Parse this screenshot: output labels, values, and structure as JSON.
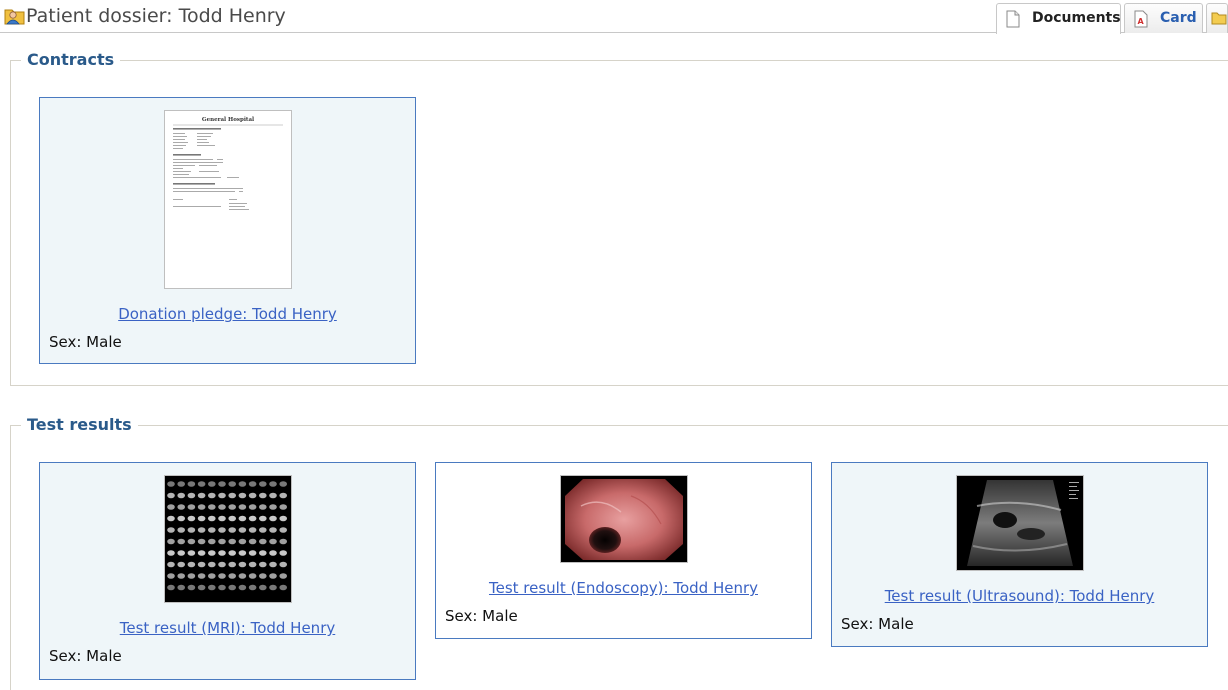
{
  "header": {
    "title": "Patient dossier: Todd Henry"
  },
  "tabs": [
    {
      "label": "Documents",
      "icon": "document-icon",
      "active": true
    },
    {
      "label": "Card",
      "icon": "pdf-card-icon",
      "active": false
    },
    {
      "label": "",
      "icon": "folder-icon",
      "active": false
    }
  ],
  "sections": {
    "contracts": {
      "legend": "Contracts",
      "items": [
        {
          "link": "Donation pledge: Todd Henry",
          "sex": "Sex: Male",
          "preview": "document-page-preview"
        }
      ]
    },
    "test_results": {
      "legend": "Test results",
      "items": [
        {
          "link": "Test result (MRI): Todd Henry",
          "sex": "Sex: Male",
          "preview": "mri-scan-image"
        },
        {
          "link": "Test result (Endoscopy): Todd Henry",
          "sex": "Sex: Male",
          "preview": "endoscopy-image"
        },
        {
          "link": "Test result (Ultrasound): Todd Henry",
          "sex": "Sex: Male",
          "preview": "ultrasound-image"
        }
      ]
    }
  },
  "preview_doc": {
    "heading": "General Hospital"
  }
}
